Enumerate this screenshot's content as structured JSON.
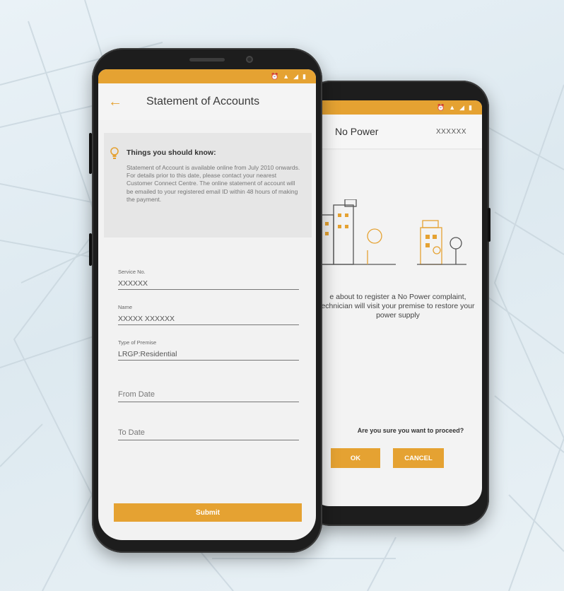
{
  "colors": {
    "accent": "#e5a232",
    "screen_bg": "#f2f2f2",
    "card_bg": "#e6e6e6"
  },
  "front": {
    "title": "Statement of Accounts",
    "back_icon": "arrow-left-icon",
    "info": {
      "heading": "Things you should know:",
      "body": "Statement of Account is available online from July 2010 onwards. For details prior to this date, please contact your nearest Customer Connect Centre. The online statement of account will be emailed to your registered email ID within 48 hours of making the payment."
    },
    "fields": {
      "service_no": {
        "label": "Service No.",
        "value": "XXXXXX"
      },
      "name": {
        "label": "Name",
        "value": "XXXXX XXXXXX"
      },
      "premise": {
        "label": "Type of Premise",
        "value": "LRGP:Residential"
      },
      "from_date": {
        "placeholder": "From Date"
      },
      "to_date": {
        "placeholder": "To Date"
      }
    },
    "submit_label": "Submit"
  },
  "back": {
    "title": "No Power",
    "account_id": "XXXXXX",
    "message": "e about to register a No Power complaint, echnician will visit your premise to restore your power supply",
    "confirm_question": "Are you sure you want to proceed?",
    "ok_label": "OK",
    "cancel_label": "CANCEL"
  }
}
